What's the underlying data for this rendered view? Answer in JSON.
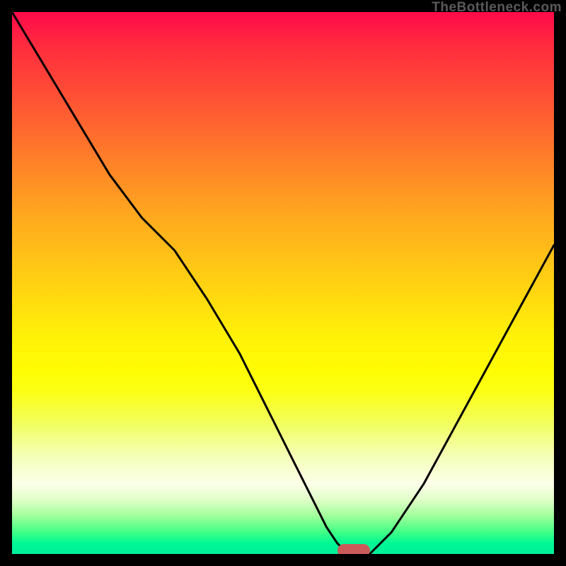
{
  "attribution": "TheBottleneck.com",
  "colors": {
    "frame": "#000000",
    "curve": "#000000",
    "marker": "#cc5a5a",
    "gradient_top": "#ff0a4a",
    "gradient_bottom": "#00f09a"
  },
  "chart_data": {
    "type": "line",
    "title": "",
    "xlabel": "",
    "ylabel": "",
    "xlim": [
      0,
      100
    ],
    "ylim": [
      0,
      100
    ],
    "x": [
      0,
      6,
      12,
      18,
      24,
      30,
      36,
      42,
      48,
      52,
      56,
      58,
      60,
      62,
      64,
      66,
      70,
      76,
      82,
      88,
      94,
      100
    ],
    "values": [
      100,
      90,
      80,
      70,
      62,
      56,
      47,
      37,
      25,
      17,
      9,
      5,
      2,
      0,
      0,
      0,
      4,
      13,
      24,
      35,
      46,
      57
    ],
    "marker": {
      "x_start": 60,
      "x_end": 66,
      "y": 0
    },
    "background": {
      "type": "vertical-gradient",
      "semantic": "bottleneck-severity",
      "stops": [
        {
          "pos": 0.0,
          "color": "#ff0a4a"
        },
        {
          "pos": 0.5,
          "color": "#ffde0e"
        },
        {
          "pos": 0.85,
          "color": "#fcffe8"
        },
        {
          "pos": 1.0,
          "color": "#00f09a"
        }
      ]
    }
  }
}
